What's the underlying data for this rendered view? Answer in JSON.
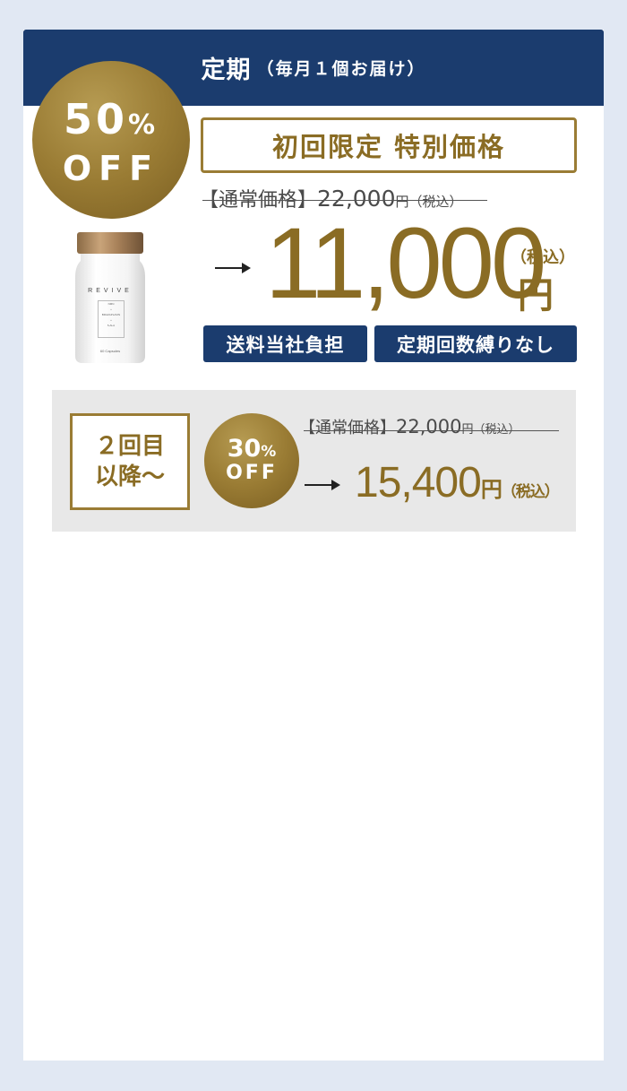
{
  "header": {
    "title": "定期",
    "subtitle": "（毎月１個お届け）"
  },
  "first_offer": {
    "badge_percent": "50",
    "badge_percent_sign": "%",
    "badge_off": "OFF",
    "limited_label": "初回限定 特別価格",
    "regular_label": "【通常価格】",
    "regular_price": "22,000",
    "regular_yen": "円",
    "regular_tax": "（税込）",
    "price": "11,000",
    "price_yen": "円",
    "price_tax": "（税込）",
    "tags": [
      "送料当社負担",
      "定期回数縛りなし"
    ]
  },
  "product": {
    "brand": "REVIVE",
    "lines": [
      "NMN",
      "+",
      "BRAZAPLAVIN",
      "+",
      "5-ALA"
    ],
    "count": "60 Capsules"
  },
  "second_offer": {
    "label_line1": "２回目",
    "label_line2": "以降〜",
    "badge_percent": "30",
    "badge_percent_sign": "%",
    "badge_off": "OFF",
    "regular_label": "【通常価格】",
    "regular_price": "22,000",
    "regular_yen": "円",
    "regular_tax": "（税込）",
    "price": "15,400",
    "price_yen": "円",
    "price_tax": "（税込）"
  },
  "colors": {
    "navy": "#1b3c6e",
    "gold": "#8a6c24",
    "background": "#e1e8f3"
  }
}
